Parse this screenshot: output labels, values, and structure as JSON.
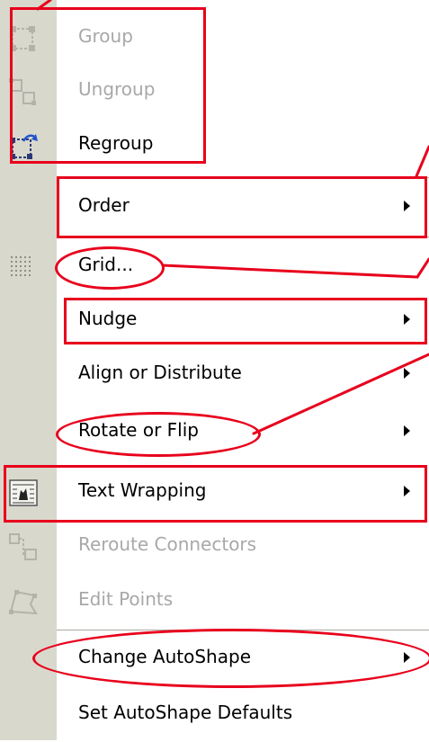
{
  "menu": {
    "items": [
      {
        "label": "Group",
        "icon": "group-icon",
        "enabled": false,
        "submenu": false
      },
      {
        "label": "Ungroup",
        "icon": "ungroup-icon",
        "enabled": false,
        "submenu": false
      },
      {
        "label": "Regroup",
        "icon": "regroup-icon",
        "enabled": true,
        "submenu": false
      },
      {
        "label": "Order",
        "icon": "",
        "enabled": true,
        "submenu": true
      },
      {
        "label": "Grid...",
        "icon": "grid-icon",
        "enabled": true,
        "submenu": false
      },
      {
        "label": "Nudge",
        "icon": "",
        "enabled": true,
        "submenu": true
      },
      {
        "label": "Align or Distribute",
        "icon": "",
        "enabled": true,
        "submenu": true
      },
      {
        "label": "Rotate or Flip",
        "icon": "",
        "enabled": true,
        "submenu": true
      },
      {
        "label": "Text Wrapping",
        "icon": "text-wrapping-icon",
        "enabled": true,
        "submenu": true
      },
      {
        "label": "Reroute Connectors",
        "icon": "reroute-connectors-icon",
        "enabled": false,
        "submenu": false
      },
      {
        "label": "Edit Points",
        "icon": "edit-points-icon",
        "enabled": false,
        "submenu": false
      },
      {
        "label": "Change AutoShape",
        "icon": "",
        "enabled": true,
        "submenu": true
      },
      {
        "label": "Set AutoShape Defaults",
        "icon": "",
        "enabled": true,
        "submenu": false
      }
    ]
  },
  "colors": {
    "gutter": "#d9d8cc",
    "annotation": "#e8001c",
    "disabled_text": "#a8a8a8"
  }
}
